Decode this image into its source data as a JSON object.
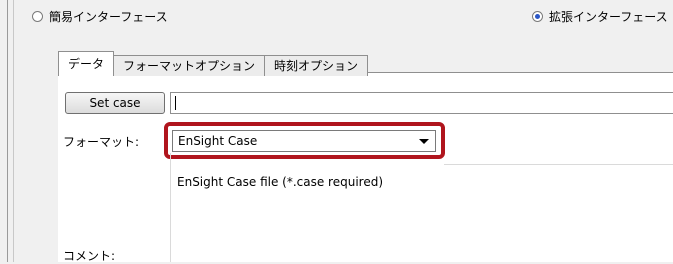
{
  "mode": {
    "simple_label": "簡易インターフェース",
    "extended_label": "拡張インターフェース",
    "selected": "extended"
  },
  "tabs": [
    {
      "label": "データ",
      "active": true
    },
    {
      "label": "フォーマットオプション",
      "active": false
    },
    {
      "label": "時刻オプション",
      "active": false
    }
  ],
  "data_tab": {
    "set_case_label": "Set case",
    "case_value": "",
    "format_label": "フォーマット:",
    "format_selected": "EnSight Case",
    "format_description": "EnSight Case file (*.case required)",
    "comment_label": "コメント:"
  },
  "colors": {
    "highlight": "#b0151d",
    "radio_selected": "#2a56c6"
  }
}
